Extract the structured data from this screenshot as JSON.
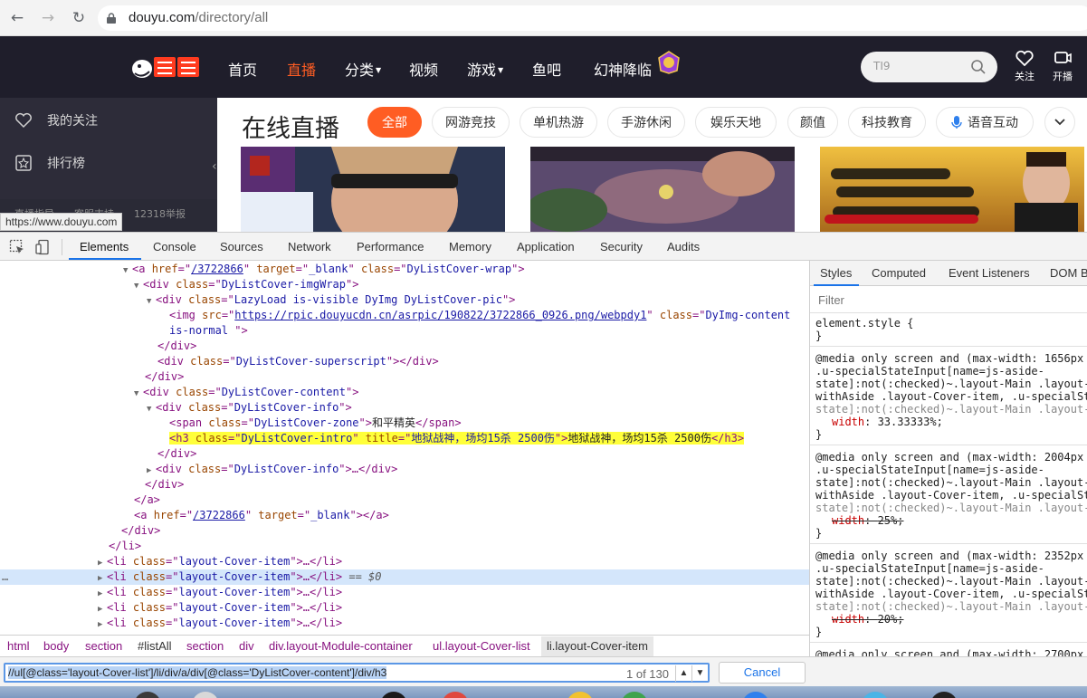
{
  "browser": {
    "url_host": "douyu.com",
    "url_path": "/directory/all",
    "tooltip": "https://www.douyu.com"
  },
  "header": {
    "nav": [
      "首页",
      "直播",
      "分类",
      "视频",
      "游戏",
      "鱼吧",
      "幻神降临"
    ],
    "active_nav": "直播",
    "search_placeholder": "TI9",
    "follow_label": "关注",
    "broadcast_label": "开播"
  },
  "sidebar": {
    "items": [
      "我的关注",
      "排行榜"
    ],
    "footer": [
      "直播指导",
      "客服支持",
      "12318举报"
    ]
  },
  "main": {
    "title": "在线直播",
    "categories": [
      "全部",
      "网游竞技",
      "单机热游",
      "手游休闲",
      "娱乐天地",
      "颜值",
      "科技教育",
      "语音互动"
    ],
    "active_category": "全部"
  },
  "devtools": {
    "tabs": [
      "Elements",
      "Console",
      "Sources",
      "Network",
      "Performance",
      "Memory",
      "Application",
      "Security",
      "Audits"
    ],
    "active_tab": "Elements",
    "dom": {
      "l1": [
        "a",
        "href",
        "/3722866",
        "target",
        "_blank",
        "class",
        "DyListCover-wrap"
      ],
      "l2": [
        "div",
        "class",
        "DyListCover-imgWrap"
      ],
      "l3": [
        "div",
        "class",
        "LazyLoad is-visible DyImg DyListCover-pic"
      ],
      "l4_src": "https://rpic.douyucdn.cn/asrpic/190822/3722866_0926.png/webpdy1",
      "l4_class": "DyImg-content",
      "l4b_class": "is-normal ",
      "l7_class": "DyListCover-superscript",
      "l9_class": "DyListCover-content",
      "l10_class": "DyListCover-info",
      "l11_class": "DyListCover-zone",
      "l11_text": "和平精英",
      "l12_class": "DyListCover-intro",
      "l12_title": "地狱战神，场均15杀 2500伤",
      "l12_text": "地狱战神，场均15杀 2500伤",
      "l13_class": "DyListCover-info",
      "l16_href": "/3722866",
      "l16_target": "_blank",
      "li_class": "layout-Cover-item",
      "selected_marker": "== $0"
    },
    "styles_tabs": [
      "Styles",
      "Computed",
      "Event Listeners",
      "DOM B"
    ],
    "styles_filter": "Filter",
    "styles": {
      "element_style": "element.style {",
      "close": "}",
      "m1": "@media only screen and (max-width: 1656px",
      "m2": "@media only screen and (max-width: 2004px",
      "m3": "@media only screen and (max-width: 2352px",
      "m4": "@media only screen and (max-width: 2700px",
      "sel_a": ".u-specialStateInput[name=js-aside-",
      "sel_b": "state]:not(:checked)~.layout-Main .layout-",
      "sel_c": "withAside .layout-Cover-item, .u-specialSt",
      "sel_d": "state]:not(:checked)~.layout-Main .layout-",
      "w1": "33.33333%;",
      "w2": "25%;",
      "w3": "20%;",
      "width_prop": "width"
    },
    "breadcrumbs": [
      "html",
      "body",
      "section",
      "#listAll",
      "section",
      "div",
      "div.layout-Module-container",
      "ul.layout-Cover-list",
      "li.layout-Cover-item"
    ],
    "xpath": "//ul[@class='layout-Cover-list']/li/div/a/div[@class='DyListCover-content']/div/h3",
    "xpath_count": "1 of 130",
    "cancel": "Cancel"
  }
}
